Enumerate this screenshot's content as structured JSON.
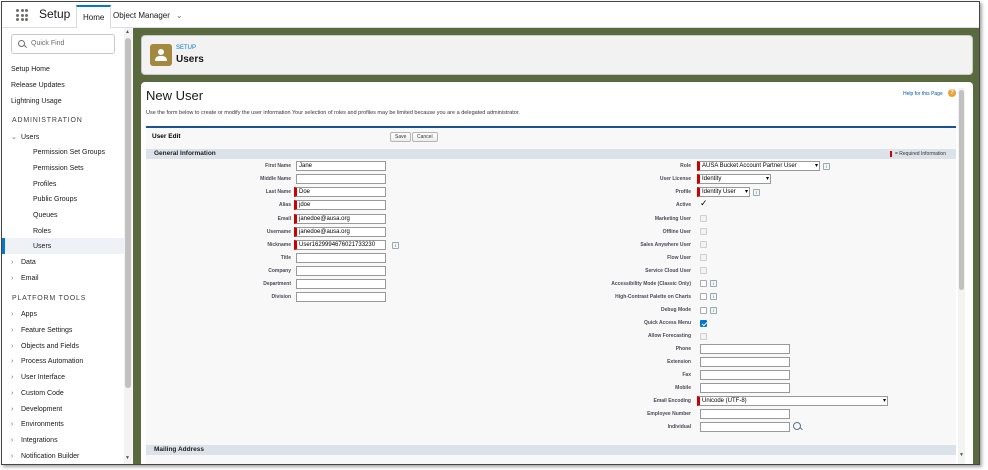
{
  "topbar": {
    "app_name": "Setup",
    "tabs": [
      {
        "label": "Home"
      },
      {
        "label": "Object Manager"
      }
    ]
  },
  "sidebar": {
    "search_placeholder": "Quick Find",
    "top_links": [
      "Setup Home",
      "Release Updates",
      "Lightning Usage"
    ],
    "section_admin": "ADMINISTRATION",
    "users_label": "Users",
    "users_children": [
      "Permission Set Groups",
      "Permission Sets",
      "Profiles",
      "Public Groups",
      "Queues",
      "Roles",
      "Users"
    ],
    "admin_more": [
      "Data",
      "Email"
    ],
    "section_platform": "PLATFORM TOOLS",
    "platform_items": [
      "Apps",
      "Feature Settings",
      "Objects and Fields",
      "Process Automation",
      "User Interface",
      "Custom Code",
      "Development",
      "Environments",
      "Integrations",
      "Notification Builder"
    ]
  },
  "header": {
    "eyebrow": "SETUP",
    "title": "Users"
  },
  "content": {
    "page_title": "New User",
    "help_link": "Help for this Page",
    "intro": "Use the form below to create or modify the user information Your selection of roles and profiles may be limited because you are a delegated administrator.",
    "block_title": "User Edit",
    "save_label": "Save",
    "cancel_label": "Cancel",
    "section_general": "General Information",
    "required_legend": "= Required Information",
    "section_mailing": "Mailing Address"
  },
  "left_fields": {
    "first_name_label": "First Name",
    "first_name_value": "Jane",
    "middle_name_label": "Middle Name",
    "middle_name_value": "",
    "last_name_label": "Last Name",
    "last_name_value": "Doe",
    "alias_label": "Alias",
    "alias_value": "jdoe",
    "email_label": "Email",
    "email_value": "janedoe@ausa.org",
    "username_label": "Username",
    "username_value": "janedoe@ausa.org",
    "nickname_label": "Nickname",
    "nickname_value": "User1629994676021733230",
    "title_label": "Title",
    "title_value": "",
    "company_label": "Company",
    "company_value": "",
    "department_label": "Department",
    "department_value": "",
    "division_label": "Division",
    "division_value": ""
  },
  "right_fields": {
    "role_label": "Role",
    "role_value": "AUSA Bucket Account Partner User",
    "user_license_label": "User License",
    "user_license_value": "Identity",
    "profile_label": "Profile",
    "profile_value": "Identity User",
    "active_label": "Active",
    "active_glyph": "✓",
    "marketing_user_label": "Marketing User",
    "offline_user_label": "Offline User",
    "sales_anywhere_user_label": "Sales Anywhere User",
    "flow_user_label": "Flow User",
    "service_cloud_user_label": "Service Cloud User",
    "accessibility_mode_label": "Accessibility Mode (Classic Only)",
    "high_contrast_label": "High-Contrast Palette on Charts",
    "debug_mode_label": "Debug Mode",
    "quick_access_menu_label": "Quick Access Menu",
    "allow_forecasting_label": "Allow Forecasting",
    "phone_label": "Phone",
    "extension_label": "Extension",
    "fax_label": "Fax",
    "mobile_label": "Mobile",
    "email_encoding_label": "Email Encoding",
    "email_encoding_value": "Unicode (UTF-8)",
    "employee_number_label": "Employee Number",
    "individual_label": "Individual"
  },
  "icons": {
    "info_glyph": "i",
    "help_glyph": "?",
    "dropdown_glyph": "▾",
    "chevron_glyph": "⌄",
    "expand_glyph": "›",
    "scroll_up_glyph": "▲",
    "scroll_down_glyph": "▼"
  },
  "colors": {
    "accent": "#0176d3",
    "required": "#cc0000",
    "header_icon": "#a3883e",
    "page_backdrop": "#5a6a3f"
  }
}
